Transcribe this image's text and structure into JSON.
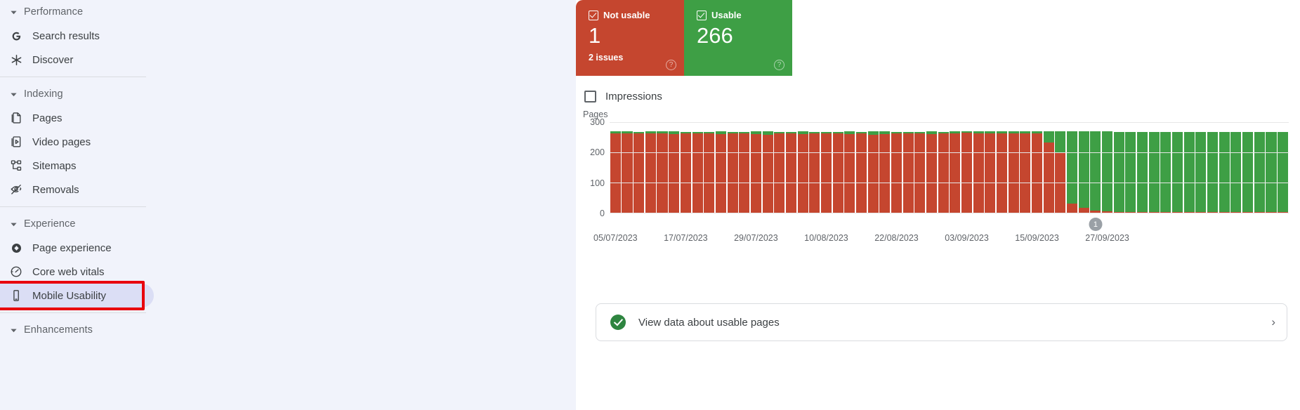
{
  "sidebar": {
    "sections": [
      {
        "label": "Performance",
        "caret": "caret-down-icon",
        "items": [
          {
            "label": "Search results",
            "icon": "google-g-icon"
          },
          {
            "label": "Discover",
            "icon": "asterisk-icon"
          }
        ]
      },
      {
        "label": "Indexing",
        "caret": "caret-down-icon",
        "items": [
          {
            "label": "Pages",
            "icon": "pages-icon"
          },
          {
            "label": "Video pages",
            "icon": "video-pages-icon"
          },
          {
            "label": "Sitemaps",
            "icon": "sitemaps-icon"
          },
          {
            "label": "Removals",
            "icon": "eye-off-icon"
          }
        ]
      },
      {
        "label": "Experience",
        "caret": "caret-down-icon",
        "items": [
          {
            "label": "Page experience",
            "icon": "page-experience-icon"
          },
          {
            "label": "Core web vitals",
            "icon": "speedometer-icon"
          },
          {
            "label": "Mobile Usability",
            "icon": "mobile-phone-icon",
            "selected": true,
            "highlighted": true
          }
        ]
      },
      {
        "label": "Enhancements",
        "caret": "caret-down-icon",
        "items": []
      }
    ]
  },
  "main": {
    "cards": [
      {
        "title": "Not usable",
        "value": "1",
        "sub": "2 issues",
        "color": "#c5462f",
        "checked": true,
        "help": "?"
      },
      {
        "title": "Usable",
        "value": "266",
        "sub": "",
        "color": "#3e9f45",
        "checked": true,
        "help": "?"
      }
    ],
    "legend": {
      "label": "Impressions",
      "checked": false
    },
    "bottom_card": {
      "label": "View data about usable pages",
      "icon": "check-circle-icon",
      "chevron": "chevron-right-icon"
    }
  },
  "chart_data": {
    "type": "bar",
    "stacked": true,
    "title": "",
    "ylabel": "Pages",
    "xlabel": "",
    "ylim": [
      0,
      300
    ],
    "yticks": [
      0,
      100,
      200,
      300
    ],
    "grid": true,
    "legend_position": "top",
    "annotations": [
      {
        "label": "1",
        "x_index": 41,
        "color": "#9aa0a6"
      }
    ],
    "tick_labels": [
      {
        "label": "05/07/2023",
        "index": 0
      },
      {
        "label": "17/07/2023",
        "index": 6
      },
      {
        "label": "29/07/2023",
        "index": 12
      },
      {
        "label": "10/08/2023",
        "index": 18
      },
      {
        "label": "22/08/2023",
        "index": 24
      },
      {
        "label": "03/09/2023",
        "index": 30
      },
      {
        "label": "15/09/2023",
        "index": 36
      },
      {
        "label": "27/09/2023",
        "index": 42
      }
    ],
    "series": [
      {
        "name": "Not usable",
        "color": "#c5462f",
        "values": [
          263,
          263,
          262,
          263,
          263,
          261,
          262,
          262,
          262,
          261,
          262,
          262,
          261,
          258,
          262,
          262,
          261,
          262,
          262,
          262,
          261,
          262,
          258,
          260,
          262,
          262,
          262,
          261,
          262,
          263,
          264,
          263,
          262,
          262,
          262,
          263,
          262,
          232,
          199,
          30,
          16,
          6,
          5,
          3,
          2,
          2,
          2,
          2,
          2,
          2,
          2,
          2,
          2,
          2,
          2,
          2,
          2,
          2
        ]
      },
      {
        "name": "Usable",
        "color": "#3e9f45",
        "values": [
          6,
          6,
          6,
          6,
          6,
          8,
          6,
          6,
          6,
          8,
          6,
          6,
          8,
          11,
          6,
          6,
          8,
          6,
          6,
          6,
          8,
          6,
          12,
          9,
          6,
          6,
          6,
          8,
          6,
          6,
          5,
          6,
          7,
          7,
          7,
          6,
          7,
          38,
          70,
          240,
          253,
          263,
          264,
          264,
          265,
          265,
          265,
          265,
          265,
          265,
          265,
          265,
          265,
          265,
          265,
          265,
          265,
          265
        ]
      }
    ]
  }
}
